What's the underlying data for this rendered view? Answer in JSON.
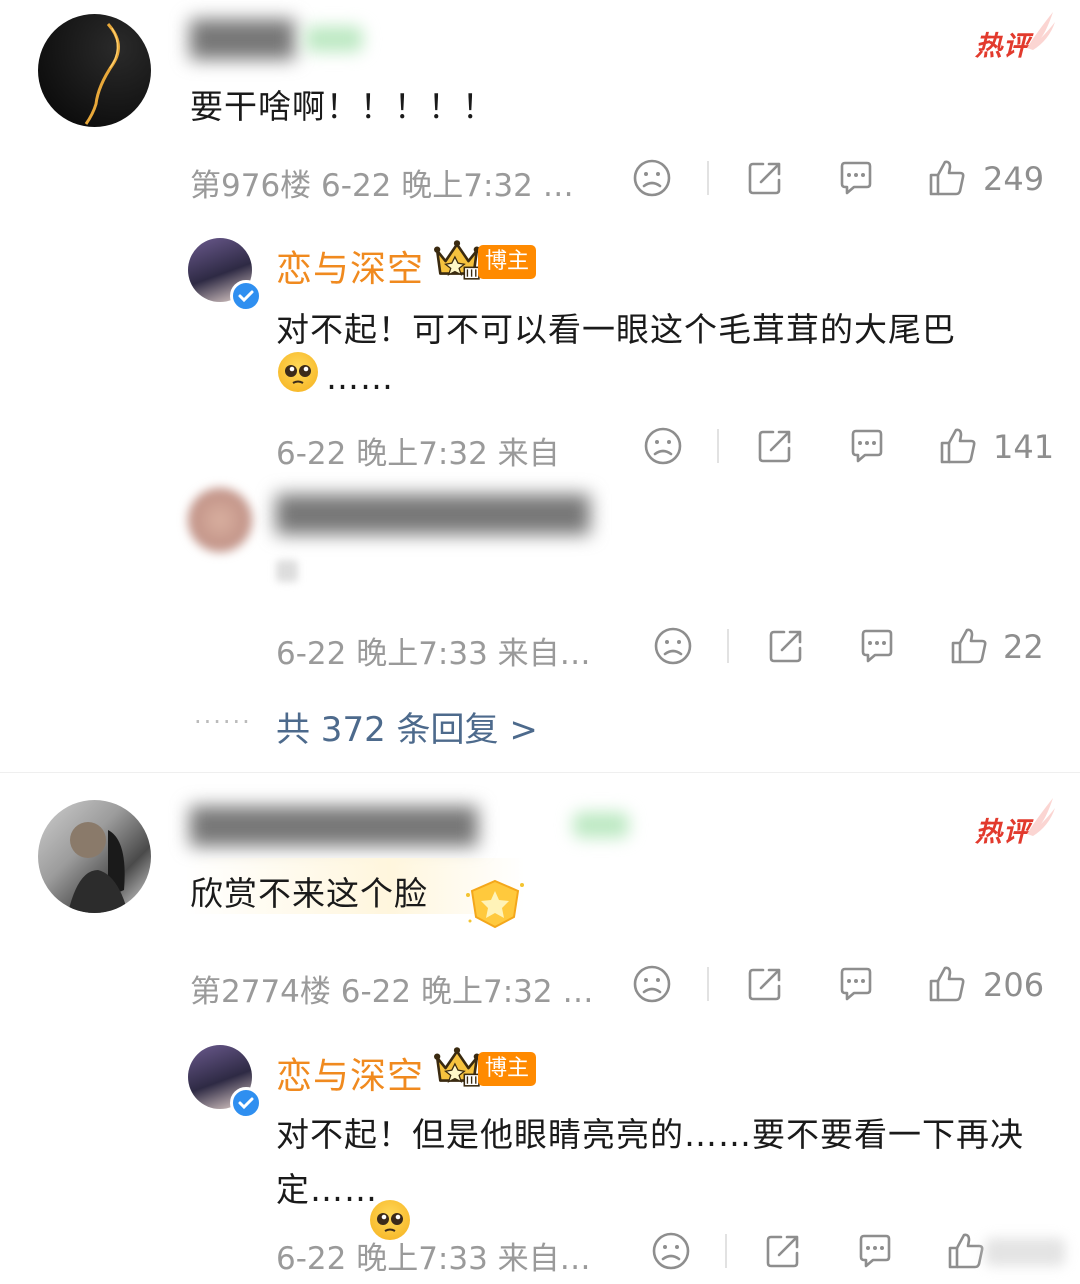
{
  "comments": [
    {
      "text": "要干啥啊！！！！！",
      "hot_label": "热评",
      "floor": "第976楼",
      "time": "6-22 晚上7:32 …",
      "likes": "249",
      "replies": [
        {
          "name": "恋与深空",
          "badge": "博主",
          "text_line1": "对不起！可不可以看一眼这个毛茸茸的大尾巴",
          "text_line2": "……",
          "time": "6-22 晚上7:32 来自",
          "likes": "141"
        },
        {
          "text": "",
          "time": "6-22 晚上7:33 来自…",
          "likes": "22"
        }
      ],
      "more_replies": "共 372 条回复 >"
    },
    {
      "text": "欣赏不来这个脸",
      "hot_label": "热评",
      "floor": "第2774楼",
      "time": "6-22 晚上7:32 …",
      "likes": "206",
      "replies": [
        {
          "name": "恋与深空",
          "badge": "博主",
          "text_line1": "对不起！但是他眼睛亮亮的……要不要看一下再决",
          "text_line2": "定……",
          "time": "6-22 晚上7:33 来自…",
          "likes": ""
        }
      ]
    }
  ],
  "colors": {
    "accent_orange": "#f08a1f",
    "hot_red": "#e23a2d",
    "link_blue": "#4d6a8c",
    "meta_gray": "#9a9a9a"
  },
  "icons": [
    "sad-face-icon",
    "share-icon",
    "comment-icon",
    "thumbs-up-icon",
    "crown-icon",
    "verified-icon",
    "pleading-emoji-icon",
    "star-shield-icon"
  ]
}
